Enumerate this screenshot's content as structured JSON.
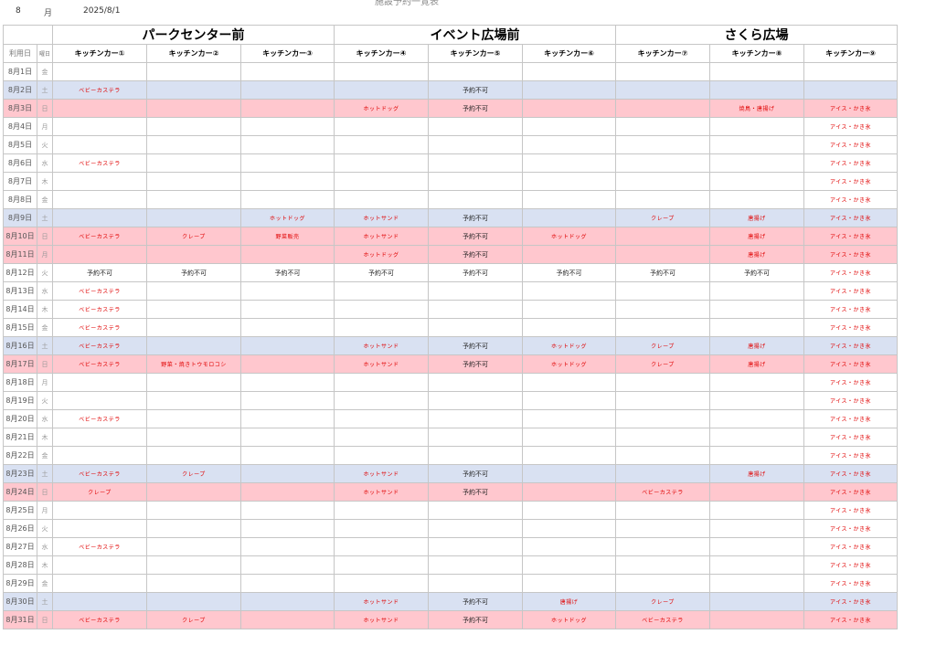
{
  "header": {
    "month": "8",
    "month_unit": "月",
    "date": "2025/8/1",
    "title": "施設予約一覧表"
  },
  "groups": [
    "パークセンター前",
    "イベント広場前",
    "さくら広場"
  ],
  "columns": {
    "date": "利用日",
    "dow": "曜日",
    "cars": [
      "キッチンカー①",
      "キッチンカー②",
      "キッチンカー③",
      "キッチンカー④",
      "キッチンカー⑤",
      "キッチンカー⑥",
      "キッチンカー⑦",
      "キッチンカー⑧",
      "キッチンカー⑨"
    ]
  },
  "rows": [
    {
      "date": "8月1日",
      "dow": "金",
      "type": "",
      "cells": [
        "",
        "",
        "",
        "",
        "",
        "",
        "",
        "",
        ""
      ]
    },
    {
      "date": "8月2日",
      "dow": "土",
      "type": "sat",
      "cells": [
        "ベビーカステラ",
        "",
        "",
        "",
        "予約不可",
        "",
        "",
        "",
        ""
      ]
    },
    {
      "date": "8月3日",
      "dow": "日",
      "type": "sun",
      "cells": [
        "",
        "",
        "",
        "ホットドッグ",
        "予約不可",
        "",
        "",
        "焼鳥・唐揚げ",
        "アイス・かき氷"
      ]
    },
    {
      "date": "8月4日",
      "dow": "月",
      "type": "",
      "cells": [
        "",
        "",
        "",
        "",
        "",
        "",
        "",
        "",
        "アイス・かき氷"
      ]
    },
    {
      "date": "8月5日",
      "dow": "火",
      "type": "",
      "cells": [
        "",
        "",
        "",
        "",
        "",
        "",
        "",
        "",
        "アイス・かき氷"
      ]
    },
    {
      "date": "8月6日",
      "dow": "水",
      "type": "",
      "cells": [
        "ベビーカステラ",
        "",
        "",
        "",
        "",
        "",
        "",
        "",
        "アイス・かき氷"
      ]
    },
    {
      "date": "8月7日",
      "dow": "木",
      "type": "",
      "cells": [
        "",
        "",
        "",
        "",
        "",
        "",
        "",
        "",
        "アイス・かき氷"
      ]
    },
    {
      "date": "8月8日",
      "dow": "金",
      "type": "",
      "cells": [
        "",
        "",
        "",
        "",
        "",
        "",
        "",
        "",
        "アイス・かき氷"
      ]
    },
    {
      "date": "8月9日",
      "dow": "土",
      "type": "sat",
      "cells": [
        "",
        "",
        "ホットドッグ",
        "ホットサンド",
        "予約不可",
        "",
        "クレープ",
        "唐揚げ",
        "アイス・かき氷"
      ]
    },
    {
      "date": "8月10日",
      "dow": "日",
      "type": "sun",
      "cells": [
        "ベビーカステラ",
        "クレープ",
        "野菜販売",
        "ホットサンド",
        "予約不可",
        "ホットドッグ",
        "",
        "唐揚げ",
        "アイス・かき氷"
      ]
    },
    {
      "date": "8月11日",
      "dow": "月",
      "type": "sun",
      "cells": [
        "",
        "",
        "",
        "ホットドッグ",
        "予約不可",
        "",
        "",
        "唐揚げ",
        "アイス・かき氷"
      ]
    },
    {
      "date": "8月12日",
      "dow": "火",
      "type": "",
      "cells": [
        "予約不可",
        "予約不可",
        "予約不可",
        "予約不可",
        "予約不可",
        "予約不可",
        "予約不可",
        "予約不可",
        "アイス・かき氷"
      ]
    },
    {
      "date": "8月13日",
      "dow": "水",
      "type": "",
      "cells": [
        "ベビーカステラ",
        "",
        "",
        "",
        "",
        "",
        "",
        "",
        "アイス・かき氷"
      ]
    },
    {
      "date": "8月14日",
      "dow": "木",
      "type": "",
      "cells": [
        "ベビーカステラ",
        "",
        "",
        "",
        "",
        "",
        "",
        "",
        "アイス・かき氷"
      ]
    },
    {
      "date": "8月15日",
      "dow": "金",
      "type": "",
      "cells": [
        "ベビーカステラ",
        "",
        "",
        "",
        "",
        "",
        "",
        "",
        "アイス・かき氷"
      ]
    },
    {
      "date": "8月16日",
      "dow": "土",
      "type": "sat",
      "cells": [
        "ベビーカステラ",
        "",
        "",
        "ホットサンド",
        "予約不可",
        "ホットドッグ",
        "クレープ",
        "唐揚げ",
        "アイス・かき氷"
      ]
    },
    {
      "date": "8月17日",
      "dow": "日",
      "type": "sun",
      "cells": [
        "ベビーカステラ",
        "野菜・焼きトウモロコシ",
        "",
        "ホットサンド",
        "予約不可",
        "ホットドッグ",
        "クレープ",
        "唐揚げ",
        "アイス・かき氷"
      ]
    },
    {
      "date": "8月18日",
      "dow": "月",
      "type": "",
      "cells": [
        "",
        "",
        "",
        "",
        "",
        "",
        "",
        "",
        "アイス・かき氷"
      ]
    },
    {
      "date": "8月19日",
      "dow": "火",
      "type": "",
      "cells": [
        "",
        "",
        "",
        "",
        "",
        "",
        "",
        "",
        "アイス・かき氷"
      ]
    },
    {
      "date": "8月20日",
      "dow": "水",
      "type": "",
      "cells": [
        "ベビーカステラ",
        "",
        "",
        "",
        "",
        "",
        "",
        "",
        "アイス・かき氷"
      ]
    },
    {
      "date": "8月21日",
      "dow": "木",
      "type": "",
      "cells": [
        "",
        "",
        "",
        "",
        "",
        "",
        "",
        "",
        "アイス・かき氷"
      ]
    },
    {
      "date": "8月22日",
      "dow": "金",
      "type": "",
      "cells": [
        "",
        "",
        "",
        "",
        "",
        "",
        "",
        "",
        "アイス・かき氷"
      ]
    },
    {
      "date": "8月23日",
      "dow": "土",
      "type": "sat",
      "cells": [
        "ベビーカステラ",
        "クレープ",
        "",
        "ホットサンド",
        "予約不可",
        "",
        "",
        "唐揚げ",
        "アイス・かき氷"
      ]
    },
    {
      "date": "8月24日",
      "dow": "日",
      "type": "sun",
      "cells": [
        "クレープ",
        "",
        "",
        "ホットサンド",
        "予約不可",
        "",
        "ベビーカステラ",
        "",
        "アイス・かき氷"
      ]
    },
    {
      "date": "8月25日",
      "dow": "月",
      "type": "",
      "cells": [
        "",
        "",
        "",
        "",
        "",
        "",
        "",
        "",
        "アイス・かき氷"
      ]
    },
    {
      "date": "8月26日",
      "dow": "火",
      "type": "",
      "cells": [
        "",
        "",
        "",
        "",
        "",
        "",
        "",
        "",
        "アイス・かき氷"
      ]
    },
    {
      "date": "8月27日",
      "dow": "水",
      "type": "",
      "cells": [
        "ベビーカステラ",
        "",
        "",
        "",
        "",
        "",
        "",
        "",
        "アイス・かき氷"
      ]
    },
    {
      "date": "8月28日",
      "dow": "木",
      "type": "",
      "cells": [
        "",
        "",
        "",
        "",
        "",
        "",
        "",
        "",
        "アイス・かき氷"
      ]
    },
    {
      "date": "8月29日",
      "dow": "金",
      "type": "",
      "cells": [
        "",
        "",
        "",
        "",
        "",
        "",
        "",
        "",
        "アイス・かき氷"
      ]
    },
    {
      "date": "8月30日",
      "dow": "土",
      "type": "sat",
      "cells": [
        "",
        "",
        "",
        "ホットサンド",
        "予約不可",
        "唐揚げ",
        "クレープ",
        "",
        "アイス・かき氷"
      ]
    },
    {
      "date": "8月31日",
      "dow": "日",
      "type": "sun",
      "cells": [
        "ベビーカステラ",
        "クレープ",
        "",
        "ホットサンド",
        "予約不可",
        "ホットドッグ",
        "ベビーカステラ",
        "",
        "アイス・かき氷"
      ]
    }
  ]
}
